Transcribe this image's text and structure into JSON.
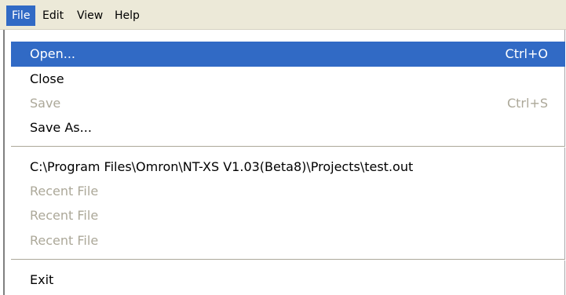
{
  "menubar": {
    "items": [
      {
        "label": "File"
      },
      {
        "label": "Edit"
      },
      {
        "label": "View"
      },
      {
        "label": "Help"
      }
    ]
  },
  "file_menu": {
    "open": {
      "label": "Open...",
      "shortcut": "Ctrl+O"
    },
    "close": {
      "label": "Close"
    },
    "save": {
      "label": "Save",
      "shortcut": "Ctrl+S"
    },
    "save_as": {
      "label": "Save As..."
    },
    "recent_1": {
      "label": "C:\\Program Files\\Omron\\NT-XS V1.03(Beta8)\\Projects\\test.out"
    },
    "recent_2": {
      "label": "Recent File"
    },
    "recent_3": {
      "label": "Recent File"
    },
    "recent_4": {
      "label": "Recent File"
    },
    "exit": {
      "label": "Exit"
    }
  },
  "colors": {
    "highlight": "#316ac5",
    "menubar_bg": "#ece9d8",
    "disabled_text": "#aca899"
  }
}
